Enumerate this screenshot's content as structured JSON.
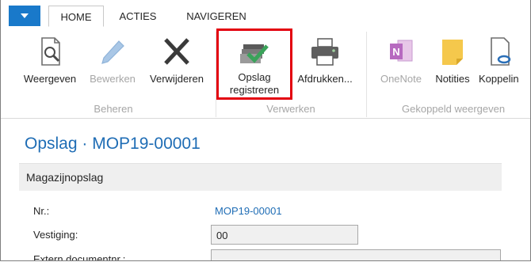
{
  "tabs": [
    {
      "label": "HOME"
    },
    {
      "label": "ACTIES"
    },
    {
      "label": "NAVIGEREN"
    }
  ],
  "ribbon": {
    "buttons": [
      {
        "label": "Weergeven",
        "icon": "view-magnifier-icon"
      },
      {
        "label": "Bewerken",
        "icon": "pencil-icon"
      },
      {
        "label": "Verwijderen",
        "icon": "delete-x-icon"
      },
      {
        "label_line1": "Opslag",
        "label_line2": "registreren",
        "icon": "register-post-icon"
      },
      {
        "label": "Afdrukken...",
        "icon": "printer-icon"
      },
      {
        "label": "OneNote",
        "icon": "onenote-icon"
      },
      {
        "label": "Notities",
        "icon": "notes-icon"
      },
      {
        "label": "Koppelin",
        "icon": "link-doc-icon"
      }
    ],
    "groups": [
      {
        "label": "Beheren"
      },
      {
        "label": "Verwerken"
      },
      {
        "label": "Gekoppeld weergeven"
      }
    ]
  },
  "page": {
    "title": "Opslag · MOP19-00001",
    "section_title": "Magazijnopslag",
    "fields": [
      {
        "label": "Nr.:",
        "value": "MOP19-00001"
      },
      {
        "label": "Vestiging:",
        "value": "00"
      },
      {
        "label": "Extern documentnr.:",
        "value": ""
      }
    ]
  },
  "colors": {
    "accent": "#1979ca",
    "title_blue": "#1f6db5",
    "highlight_red": "#e3000f",
    "check_green": "#3aa35a"
  }
}
